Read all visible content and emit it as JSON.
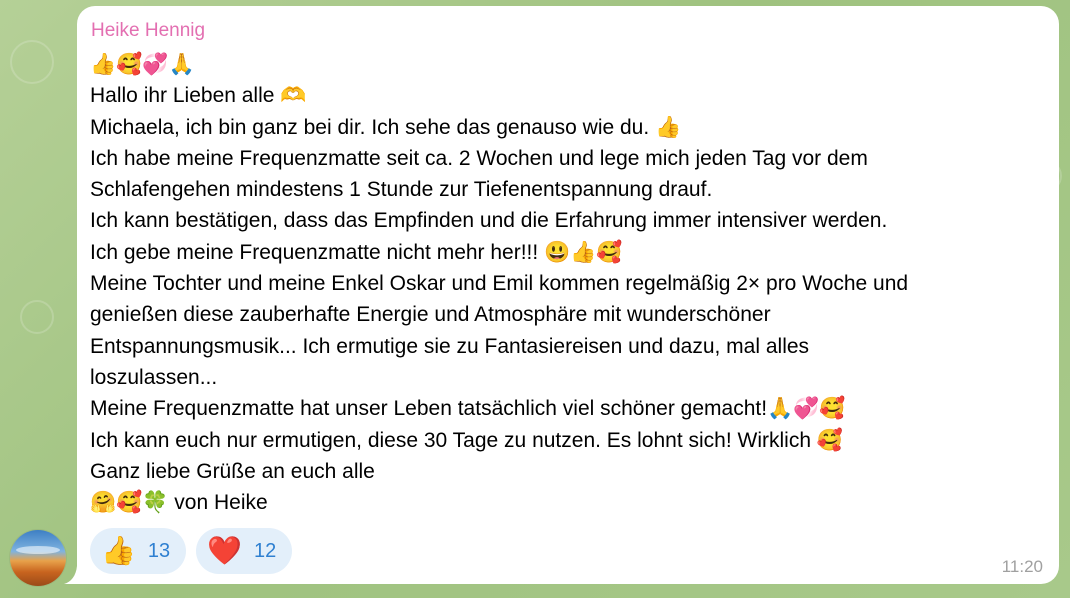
{
  "message": {
    "sender": "Heike Hennig",
    "lines": [
      "👍🥰💞🙏",
      "Hallo ihr Lieben alle 🫶",
      "Michaela, ich bin ganz bei dir. Ich sehe das genauso wie du. 👍",
      "Ich habe  meine Frequenzmatte seit ca. 2 Wochen und lege mich jeden Tag vor dem",
      "Schlafengehen mindestens 1 Stunde zur Tiefenentspannung drauf.",
      "Ich kann bestätigen, dass das Empfinden und die Erfahrung immer intensiver werden.",
      "Ich gebe meine Frequenzmatte nicht mehr her!!! 😃👍🥰",
      "Meine Tochter und meine Enkel Oskar und Emil kommen regelmäßig 2× pro Woche und",
      "genießen diese zauberhafte Energie und Atmosphäre mit wunderschöner",
      "Entspannungsmusik... Ich ermutige sie zu Fantasiereisen und dazu, mal alles",
      "loszulassen...",
      "Meine Frequenzmatte hat unser Leben tatsächlich viel schöner gemacht!🙏💞🥰",
      "Ich kann euch nur ermutigen, diese 30 Tage zu nutzen. Es lohnt sich! Wirklich 🥰",
      "Ganz liebe Grüße an euch alle",
      "🤗🥰🍀 von Heike"
    ],
    "time": "11:20",
    "reactions": [
      {
        "emoji": "👍",
        "count": "13"
      },
      {
        "emoji": "❤️",
        "count": "12"
      }
    ]
  },
  "colors": {
    "sender": "#e36fb1",
    "reaction_bg": "#e3effa",
    "reaction_count": "#2f80d1",
    "timestamp": "#a0a0a0",
    "wallpaper": "#a9c98a"
  }
}
